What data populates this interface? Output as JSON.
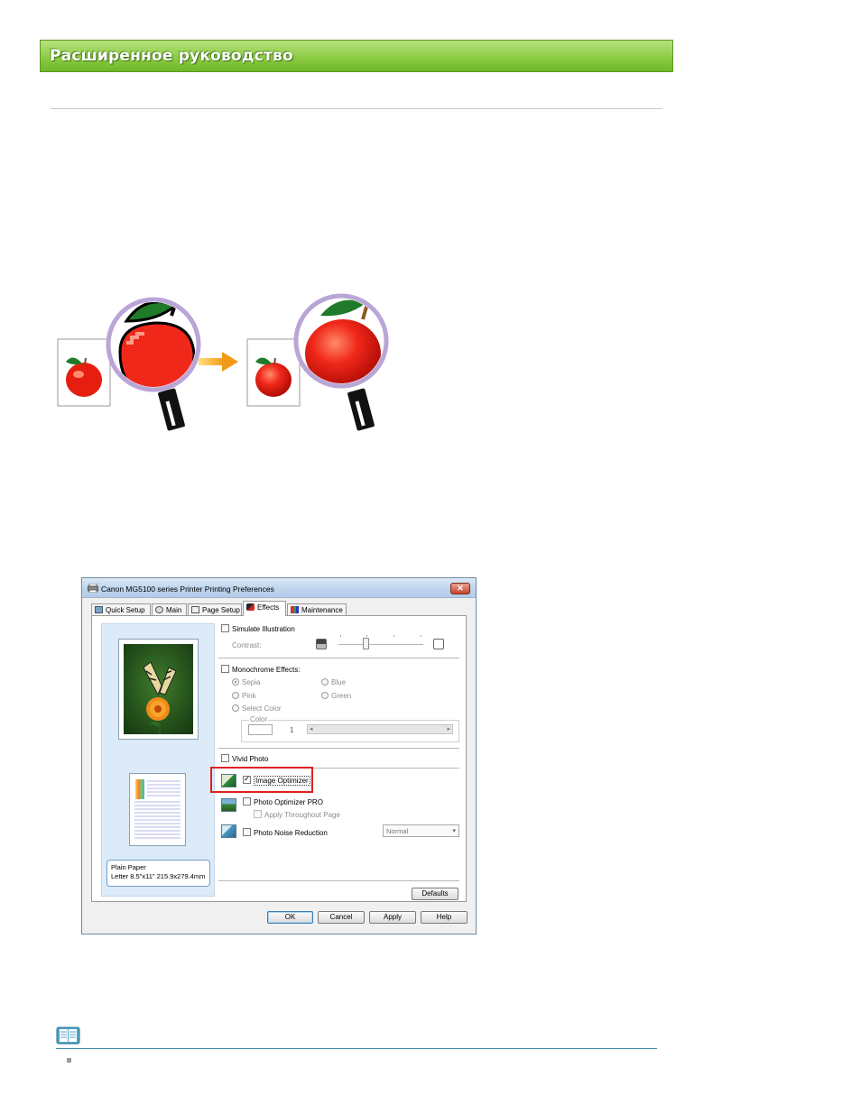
{
  "header": {
    "title": "Расширенное руководство"
  },
  "dialog": {
    "title": "Canon MG5100 series Printer Printing Preferences",
    "close_label": "✕",
    "tabs": [
      {
        "label": "Quick Setup"
      },
      {
        "label": "Main"
      },
      {
        "label": "Page Setup"
      },
      {
        "label": "Effects",
        "active": true
      },
      {
        "label": "Maintenance"
      }
    ],
    "preview": {
      "paper_type": "Plain Paper",
      "paper_size": "Letter 8.5\"x11\" 215.9x279.4mm"
    },
    "effects": {
      "simulate_illustration": {
        "label": "Simulate Illustration",
        "checked": false
      },
      "contrast_label": "Contrast:",
      "monochrome": {
        "label": "Monochrome Effects:",
        "checked": false
      },
      "radios": {
        "sepia": "Sepia",
        "blue": "Blue",
        "pink": "Pink",
        "green": "Green",
        "select_color": "Select Color"
      },
      "color_label": "Color",
      "color_value": "1",
      "vivid_photo": {
        "label": "Vivid Photo",
        "checked": false
      },
      "image_optimizer": {
        "label": "Image Optimizer",
        "checked": true
      },
      "photo_optimizer_pro": {
        "label": "Photo Optimizer PRO",
        "checked": false
      },
      "apply_throughout_page": {
        "label": "Apply Throughout Page",
        "checked": false
      },
      "photo_noise_reduction": {
        "label": "Photo Noise Reduction",
        "checked": false
      },
      "noise_level": "Normal"
    },
    "buttons": {
      "defaults": "Defaults",
      "ok": "OK",
      "cancel": "Cancel",
      "apply": "Apply",
      "help": "Help"
    }
  },
  "colors": {
    "banner": "#8ccc44",
    "highlight": "#e02020",
    "note_rule": "#3d8fb0"
  },
  "icons": [
    "printer-icon",
    "close-icon",
    "note-book-icon",
    "magnifier-icon",
    "arrow-right-icon"
  ]
}
